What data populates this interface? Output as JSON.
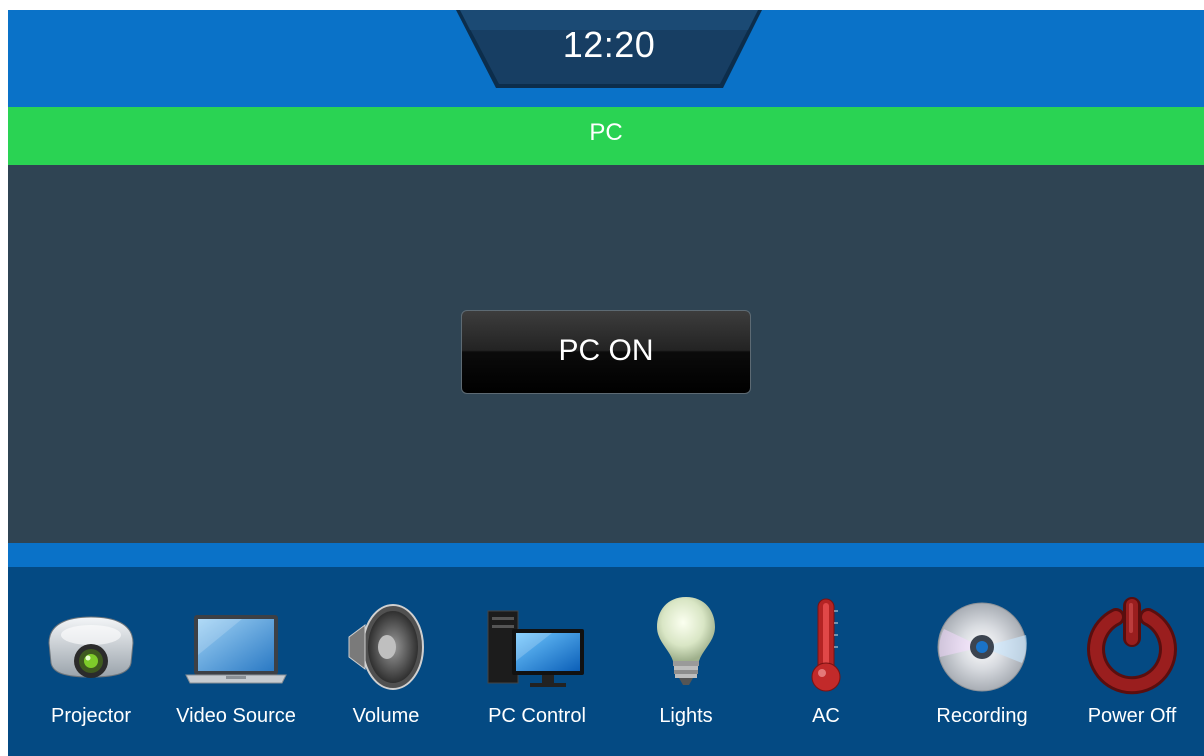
{
  "header": {
    "time": "12:20"
  },
  "source_bar": {
    "label": "PC"
  },
  "main": {
    "pc_on_button": "PC ON"
  },
  "nav": {
    "items": [
      {
        "label": "Projector",
        "icon": "projector-icon"
      },
      {
        "label": "Video Source",
        "icon": "laptop-icon"
      },
      {
        "label": "Volume",
        "icon": "speaker-icon"
      },
      {
        "label": "PC Control",
        "icon": "desktop-computer-icon"
      },
      {
        "label": "Lights",
        "icon": "light-bulb-icon"
      },
      {
        "label": "AC",
        "icon": "thermometer-icon"
      },
      {
        "label": "Recording",
        "icon": "disc-icon"
      },
      {
        "label": "Power Off",
        "icon": "power-icon"
      }
    ]
  },
  "colors": {
    "header_blue": "#0a72c8",
    "source_green": "#2ad353",
    "content_bg": "#2f4453",
    "footer_blue": "#044a83",
    "power_red": "#8b1a1a"
  }
}
